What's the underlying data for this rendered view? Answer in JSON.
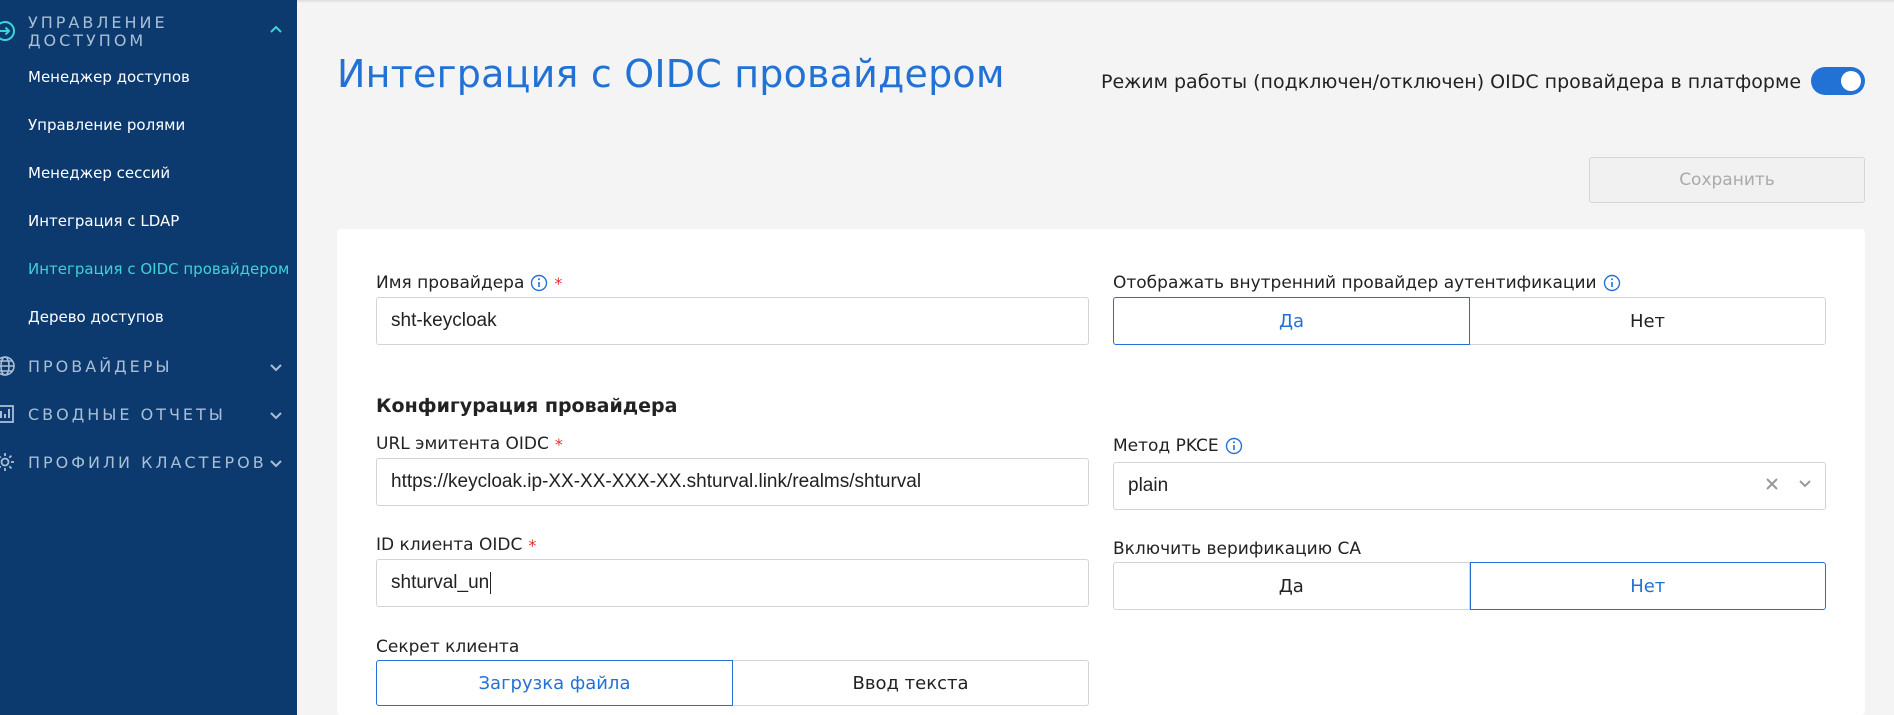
{
  "sidebar": {
    "group_access": "УПРАВЛЕНИЕ ДОСТУПОМ",
    "items": [
      {
        "label": "Менеджер доступов"
      },
      {
        "label": "Управление ролями"
      },
      {
        "label": "Менеджер сессий"
      },
      {
        "label": "Интеграция с LDAP"
      },
      {
        "label": "Интеграция с OIDC провайдером"
      },
      {
        "label": "Дерево доступов"
      }
    ],
    "groups": [
      {
        "label": "ПРОВАЙДЕРЫ",
        "icon": "globe-icon"
      },
      {
        "label": "СВОДНЫЕ ОТЧЕТЫ",
        "icon": "report-icon"
      },
      {
        "label": "ПРОФИЛИ КЛАСТЕРОВ",
        "icon": "gear-icon"
      }
    ],
    "accent_color": "#3fd2d8",
    "bg_color": "#0c3a6e"
  },
  "header": {
    "title": "Интеграция с OIDC провайдером",
    "mode_label": "Режим работы (подключен/отключен) OIDC провайдера в платформе",
    "mode_enabled": true,
    "save_label": "Сохранить"
  },
  "form": {
    "provider_name_label": "Имя провайдера",
    "provider_name_value": "sht-keycloak",
    "show_internal_label": "Отображать внутренний провайдер аутентификации",
    "show_internal_yes": "Да",
    "show_internal_no": "Нет",
    "config_title": "Конфигурация провайдера",
    "issuer_label": "URL эмитента OIDC",
    "issuer_value": "https://keycloak.ip-XX-XX-XXX-XX.shturval.link/realms/shturval",
    "pkce_label": "Метод PKCE",
    "pkce_value": "plain",
    "client_id_label": "ID клиента OIDC",
    "client_id_value": "shturval_un",
    "ca_label": "Включить верификацию CA",
    "ca_yes": "Да",
    "ca_no": "Нет",
    "secret_label": "Секрет клиента",
    "secret_file": "Загрузка файла",
    "secret_text": "Ввод текста",
    "required_mark": "*"
  },
  "colors": {
    "primary": "#2272d6",
    "required": "#e0302e"
  }
}
